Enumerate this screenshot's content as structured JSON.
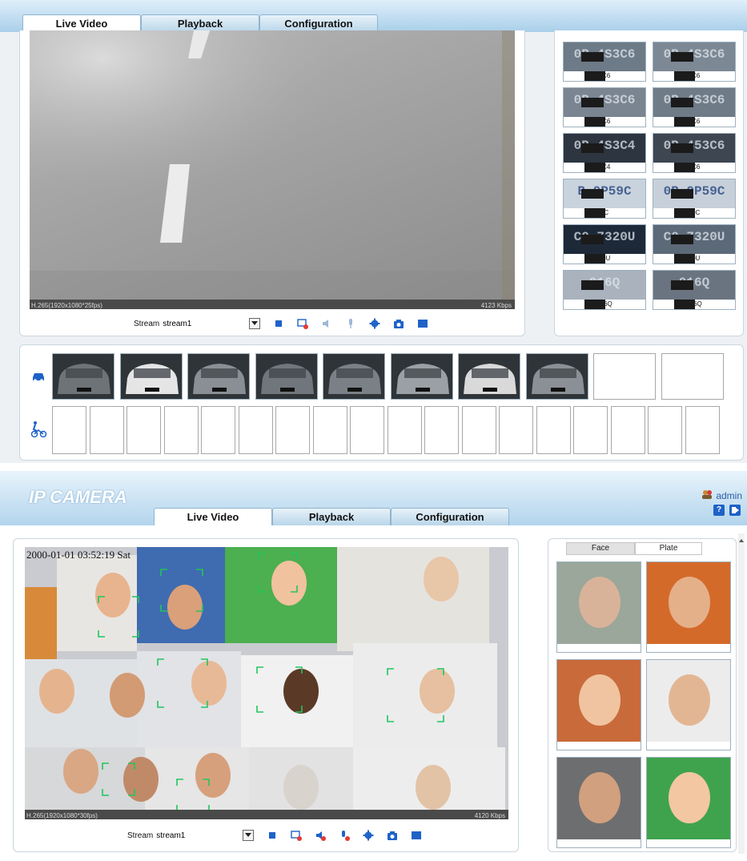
{
  "screen1": {
    "tabs": [
      {
        "label": "Live Video",
        "active": true
      },
      {
        "label": "Playback",
        "active": false
      },
      {
        "label": "Configuration",
        "active": false
      }
    ],
    "video": {
      "codec_info": "H.265(1920x1080*25fps)",
      "bitrate": "4123 Kbps"
    },
    "stream": {
      "label": "Stream",
      "value": "stream1"
    },
    "plates": [
      {
        "text": "3C6"
      },
      {
        "text": "3C6"
      },
      {
        "text": "3C6"
      },
      {
        "text": "3C6"
      },
      {
        "text": "3C4"
      },
      {
        "text": "3C6"
      },
      {
        "text": "9C"
      },
      {
        "text": "59C"
      },
      {
        "text": "20U"
      },
      {
        "text": "20U"
      },
      {
        "text": "016Q"
      },
      {
        "text": "016Q"
      }
    ],
    "plate_images": [
      "0B 4S3C6",
      "0B 4S3C6",
      "0B 4S3C6",
      "0B 4S3C6",
      "0B 4S3C4",
      "0B 453C6",
      "B 0P59C",
      "0B 0P59C",
      "C0 7320U",
      "C0 7320U",
      "016Q",
      "016Q"
    ],
    "vehicle_count": 8,
    "vehicle_empty": 2,
    "person_empty": 18
  },
  "screen2": {
    "logo": "IP CAMERA",
    "user": "admin",
    "tabs": [
      {
        "label": "Live Video",
        "active": true
      },
      {
        "label": "Playback",
        "active": false
      },
      {
        "label": "Configuration",
        "active": false
      }
    ],
    "video": {
      "timestamp": "2000-01-01 03:52:19 Sat",
      "codec_info": "H.265(1920x1080*30fps)",
      "bitrate": "4120 Kbps"
    },
    "stream": {
      "label": "Stream",
      "value": "stream1"
    },
    "side_tabs": [
      {
        "label": "Face",
        "active": true
      },
      {
        "label": "Plate",
        "active": false
      }
    ]
  },
  "colors": {
    "accent": "#1565c0",
    "tab_bg": "#b9d6ea",
    "header_bg": "#a9cfe9",
    "face_box": "#22c55e"
  },
  "icons": [
    "stop-icon",
    "record-icon",
    "audio-icon",
    "microphone-icon",
    "settings-icon",
    "snapshot-icon",
    "fullscreen-icon",
    "vehicle-icon",
    "person-bike-icon",
    "user-icon",
    "help-icon",
    "logout-icon"
  ]
}
